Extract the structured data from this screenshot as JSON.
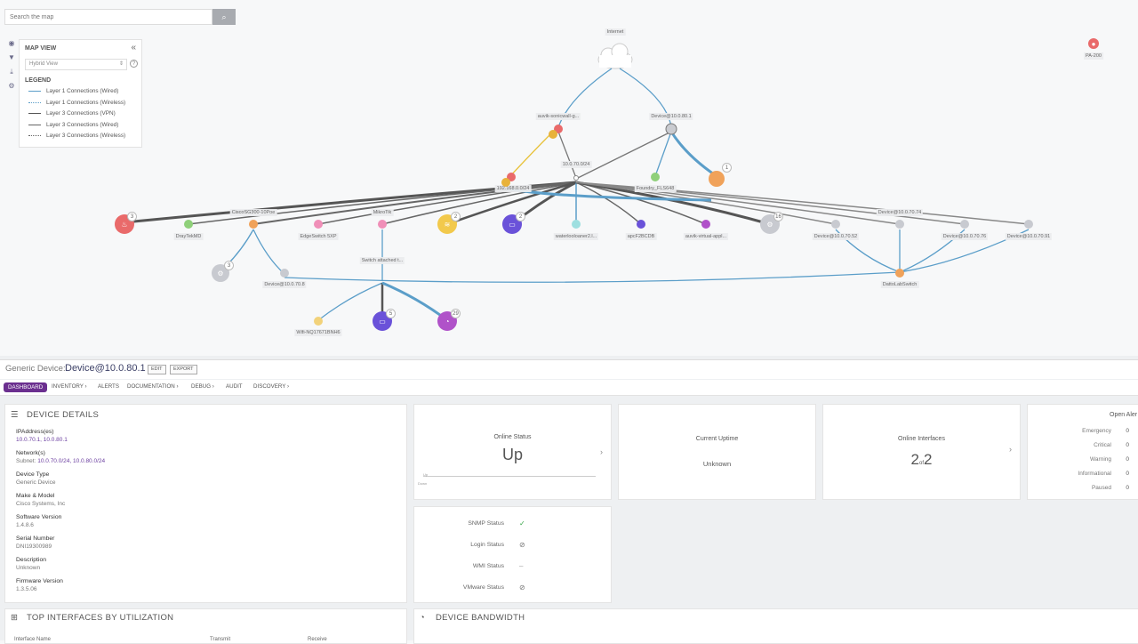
{
  "search": {
    "placeholder": "Search the map"
  },
  "map_view": {
    "title": "MAP VIEW",
    "view_select": "Hybrid View",
    "legend_title": "LEGEND",
    "legend": [
      "Layer 1 Connections (Wired)",
      "Layer 1 Connections (Wireless)",
      "Layer 3 Connections (VPN)",
      "Layer 3 Connections (Wired)",
      "Layer 3 Connections (Wireless)"
    ]
  },
  "map": {
    "labels": {
      "internet": "Internet",
      "pa200": "PA-200",
      "auvik_sonicwall": "auvik-sonicwall-g...",
      "device_80_1": "Device@10.0.80.1",
      "subnet_70": "10.0.70.0/24",
      "subnet_192": "192.168.0.0/24",
      "foundry": "Foundry_FLS648",
      "draytek": "DrayTekMD",
      "cisco": "CiscoSG300-10Poe",
      "edgeswitch": "EdgeSwitch 5XP",
      "mikrotik": "MikroTik",
      "waterloo": "waterlooloaner2.l...",
      "apc": "apcF2BCDB",
      "auvik_virtual": "auvik-virtual-appl...",
      "device_70_52": "Device@10.0.70.52",
      "device_70_74": "Device@10.0.70.74",
      "device_70_76": "Device@10.0.70.76",
      "device_70_91": "Device@10.0.70.91",
      "switch_attached": "Switch attached t...",
      "device_70_8": "Device@10.0.70.8",
      "datto": "DattoLabSwitch",
      "wifi": "Wifi-NQ17671BNH6"
    },
    "badges": {
      "fire": "3",
      "sonicwall": "1",
      "sonic_grp": "1",
      "yellow_big": "2",
      "purple_big": "2",
      "gray_big": "16",
      "device_cluster": "5",
      "gray_left": "3",
      "blue_bottom": "5",
      "purple_bottom": "29"
    }
  },
  "device": {
    "type_label": "Generic Device:",
    "name": "Device@10.0.80.1",
    "edit": "EDIT",
    "export": "EXPORT"
  },
  "tabs": [
    "DASHBOARD",
    "INVENTORY ›",
    "ALERTS",
    "DOCUMENTATION ›",
    "DEBUG ›",
    "AUDIT",
    "DISCOVERY ›"
  ],
  "details": {
    "title": "DEVICE DETAILS",
    "ip_label": "IPAddress(es)",
    "ip_value": "10.0.70.1, 10.0.80.1",
    "net_label": "Network(s)",
    "net_prefix": "Subnet:",
    "net_value": "10.0.70.0/24, 10.0.80.0/24",
    "type_label": "Device Type",
    "type_value": "Generic Device",
    "make_label": "Make & Model",
    "make_value": "Cisco Systems, Inc",
    "sw_label": "Software Version",
    "sw_value": "1.4.8.6",
    "serial_label": "Serial Number",
    "serial_value": "DNI19300989",
    "desc_label": "Description",
    "desc_value": "Unknown",
    "fw_label": "Firmware Version",
    "fw_value": "1.3.5.06"
  },
  "online_status": {
    "title": "Online Status",
    "value": "Up",
    "axis_up": "Up",
    "axis_down": "Down"
  },
  "uptime": {
    "title": "Current Uptime",
    "value": "Unknown"
  },
  "interfaces": {
    "title": "Online Interfaces",
    "count": "2",
    "of": "of",
    "total": "2"
  },
  "alerts": {
    "title": "Open Aler",
    "rows": [
      {
        "label": "Emergency",
        "value": "0"
      },
      {
        "label": "Critical",
        "value": "0"
      },
      {
        "label": "Warning",
        "value": "0"
      },
      {
        "label": "Informational",
        "value": "0"
      },
      {
        "label": "Paused",
        "value": "0"
      }
    ]
  },
  "statuses": [
    {
      "label": "SNMP Status",
      "value": "✓",
      "color": "#3aa64a"
    },
    {
      "label": "Login Status",
      "value": "⊘",
      "color": "#777777"
    },
    {
      "label": "WMI Status",
      "value": "–",
      "color": "#999999"
    },
    {
      "label": "VMware Status",
      "value": "⊘",
      "color": "#777777"
    }
  ],
  "top_interfaces": {
    "title": "TOP INTERFACES BY UTILIZATION",
    "col1": "Interface Name",
    "col2": "Transmit",
    "col3": "Receive"
  },
  "bandwidth": {
    "title": "DEVICE BANDWIDTH"
  }
}
